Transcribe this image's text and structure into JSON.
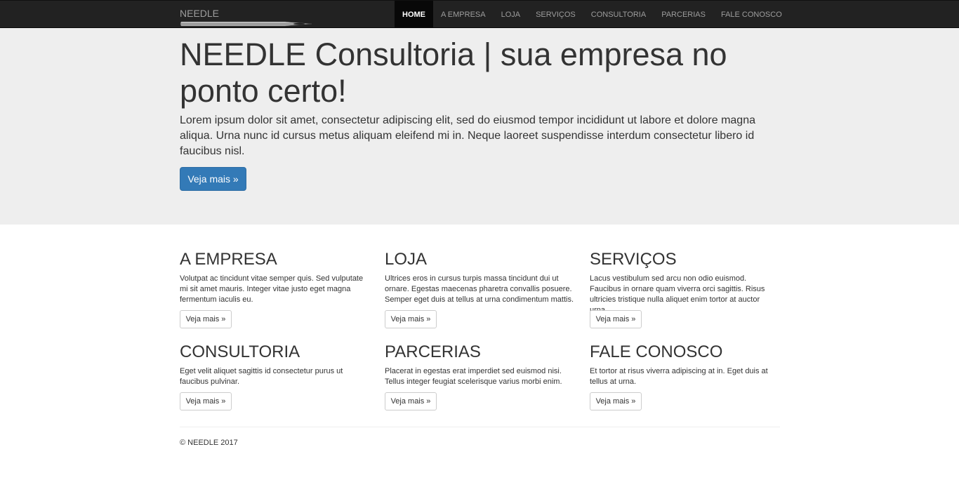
{
  "navbar": {
    "brand": "NEEDLE",
    "items": [
      "HOME",
      "A EMPRESA",
      "LOJA",
      "SERVIÇOS",
      "CONSULTORIA",
      "PARCERIAS",
      "FALE CONOSCO"
    ],
    "active_index": 0
  },
  "jumbotron": {
    "title": "NEEDLE Consultoria | sua empresa no ponto certo!",
    "lead": "Lorem ipsum dolor sit amet, consectetur adipiscing elit, sed do eiusmod tempor incididunt ut labore et dolore magna aliqua. Urna nunc id cursus metus aliquam eleifend mi in. Neque laoreet suspendisse interdum consectetur libero id faucibus nisl.",
    "button": "Veja mais »"
  },
  "features": [
    {
      "title": "A EMPRESA",
      "text": "Volutpat ac tincidunt vitae semper quis. Sed vulputate mi sit amet mauris. Integer vitae justo eget magna fermentum iaculis eu.",
      "button": "Veja mais »"
    },
    {
      "title": "LOJA",
      "text": "Ultrices eros in cursus turpis massa tincidunt dui ut ornare. Egestas maecenas pharetra convallis posuere. Semper eget duis at tellus at urna condimentum mattis.",
      "button": "Veja mais »"
    },
    {
      "title": "SERVIÇOS",
      "text": "Lacus vestibulum sed arcu non odio euismod. Faucibus in ornare quam viverra orci sagittis. Risus ultricies tristique nulla aliquet enim tortor at auctor urna.",
      "button": "Veja mais »"
    },
    {
      "title": "CONSULTORIA",
      "text": "Eget velit aliquet sagittis id consectetur purus ut faucibus pulvinar.",
      "button": "Veja mais »"
    },
    {
      "title": "PARCERIAS",
      "text": "Placerat in egestas erat imperdiet sed euismod nisi. Tellus integer feugiat scelerisque varius morbi enim.",
      "button": "Veja mais »"
    },
    {
      "title": "FALE CONOSCO",
      "text": "Et tortor at risus viverra adipiscing at in. Eget duis at tellus at urna.",
      "button": "Veja mais »"
    }
  ],
  "footer": {
    "text": "© NEEDLE 2017"
  },
  "colors": {
    "navbar_bg": "#222222",
    "jumbotron_bg": "#eeeeee",
    "primary": "#337ab7"
  }
}
